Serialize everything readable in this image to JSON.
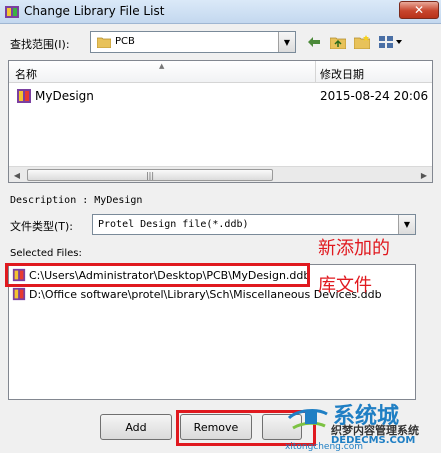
{
  "window": {
    "title": "Change Library File List",
    "close_label": "✕"
  },
  "lookin": {
    "label": "查找范围(I):",
    "value": "PCB"
  },
  "file_list": {
    "columns": [
      "名称",
      "修改日期"
    ],
    "rows": [
      {
        "name": "MyDesign",
        "date": "2015-08-24 20:06"
      }
    ]
  },
  "description": "Description : MyDesign",
  "file_type": {
    "label": "文件类型(T):",
    "value": "Protel Design file(*.ddb)"
  },
  "selected_files": {
    "label": "Selected Files:",
    "items": [
      "C:\\Users\\Administrator\\Desktop\\PCB\\MyDesign.ddb",
      "D:\\Office software\\protel\\Library\\Sch\\Miscellaneous Devices.ddb"
    ]
  },
  "annotation": {
    "line1": "新添加的",
    "line2": "库文件",
    "color": "#e0191f"
  },
  "buttons": {
    "add": "Add",
    "remove": "Remove"
  },
  "watermark": {
    "brand": "系统城",
    "line2": "织梦内容管理系统",
    "line3": "DEDECMS.COM",
    "url": "xitongcheng.com"
  }
}
